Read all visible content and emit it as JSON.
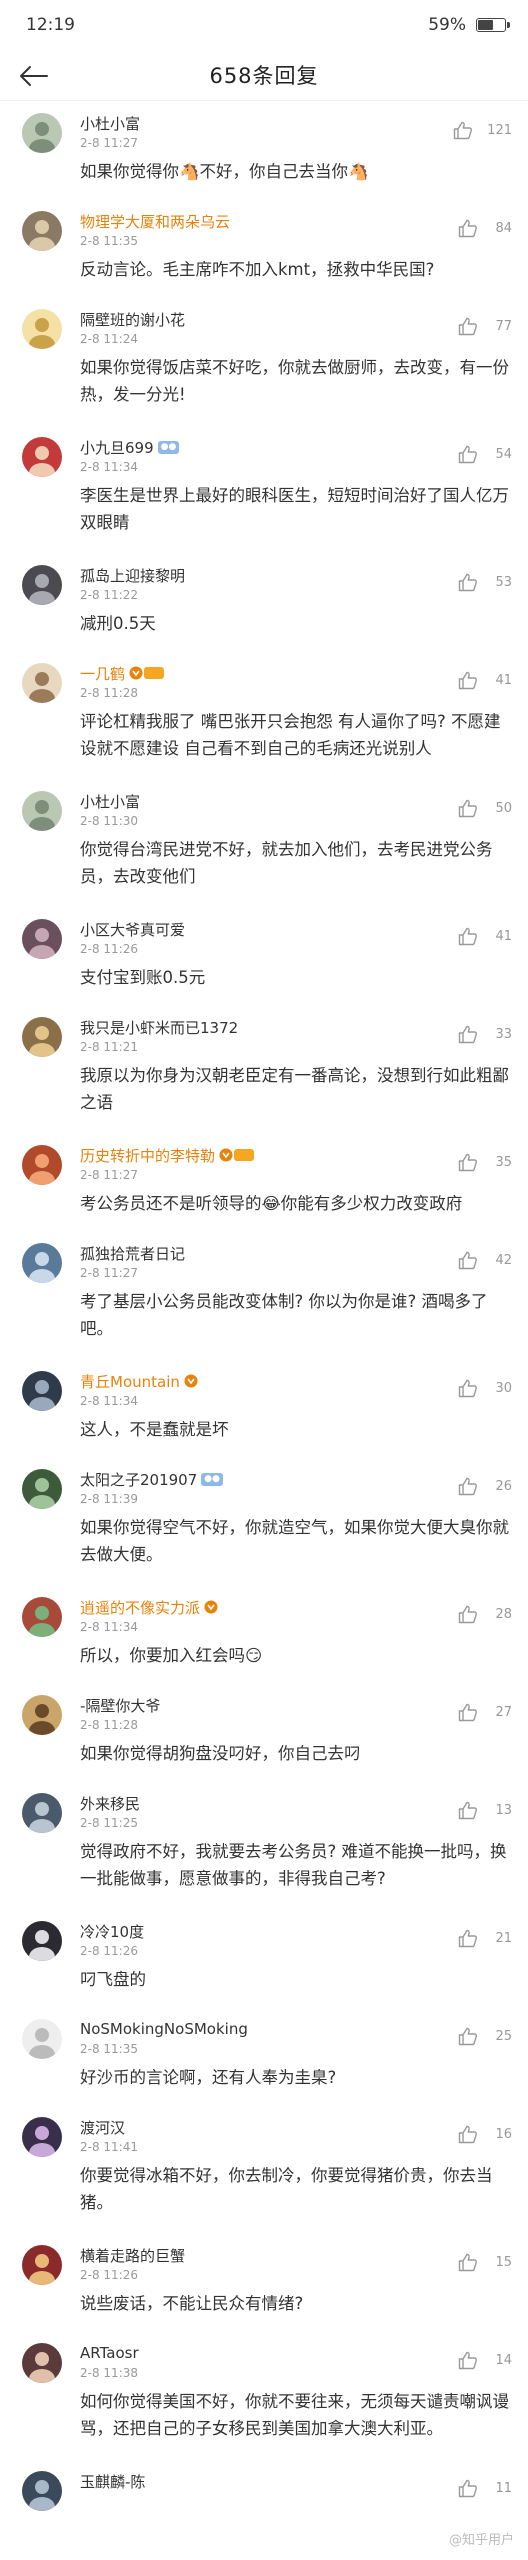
{
  "status_bar": {
    "time": "12:19",
    "battery": "59%",
    "battery_level": 0.59
  },
  "header": {
    "title": "658条回复"
  },
  "comments": [
    {
      "name": "小杜小富",
      "name_style": "normal",
      "badge": "",
      "date": "2-8 11:27",
      "likes": "121",
      "text": "如果你觉得你🐴不好，你自己去当你🐴",
      "avatar_color": "#b9c7b3",
      "avatar_fg": "#7d8f7a"
    },
    {
      "name": "物理学大厦和两朵乌云",
      "name_style": "vip",
      "badge": "",
      "date": "2-8 11:35",
      "likes": "84",
      "text": "反动言论。毛主席咋不加入kmt，拯救中华民国?",
      "avatar_color": "#8a7a64",
      "avatar_fg": "#d9c9a8"
    },
    {
      "name": "隔壁班的谢小花",
      "name_style": "normal",
      "badge": "",
      "date": "2-8 11:24",
      "likes": "77",
      "text": "如果你觉得饭店菜不好吃，你就去做厨师，去改变，有一份热，发一分光!",
      "avatar_color": "#f3e1a6",
      "avatar_fg": "#c9a24a"
    },
    {
      "name": "小九旦699",
      "name_style": "normal",
      "badge": "lv",
      "date": "2-8 11:34",
      "likes": "54",
      "text": "李医生是世界上最好的眼科医生，短短时间治好了国人亿万双眼睛",
      "avatar_color": "#c23a3a",
      "avatar_fg": "#f1c8b0"
    },
    {
      "name": "孤岛上迎接黎明",
      "name_style": "normal",
      "badge": "",
      "date": "2-8 11:22",
      "likes": "53",
      "text": "减刑0.5天",
      "avatar_color": "#4a4a50",
      "avatar_fg": "#a8a8b0"
    },
    {
      "name": "一几鹤",
      "name_style": "vip",
      "badge": "vip",
      "date": "2-8 11:28",
      "likes": "41",
      "text": "评论杠精我服了 嘴巴张开只会抱怨 有人逼你了吗? 不愿建设就不愿建设 自己看不到自己的毛病还光说别人",
      "avatar_color": "#e8d8c0",
      "avatar_fg": "#9b7b5a"
    },
    {
      "name": "小杜小富",
      "name_style": "normal",
      "badge": "",
      "date": "2-8 11:30",
      "likes": "50",
      "text": "你觉得台湾民进党不好，就去加入他们，去考民进党公务员，去改变他们",
      "avatar_color": "#b9c7b3",
      "avatar_fg": "#7d8f7a"
    },
    {
      "name": "小区大爷真可爱",
      "name_style": "normal",
      "badge": "",
      "date": "2-8 11:26",
      "likes": "41",
      "text": "支付宝到账0.5元",
      "avatar_color": "#6a4f5c",
      "avatar_fg": "#c7a6b4"
    },
    {
      "name": "我只是小虾米而已1372",
      "name_style": "normal",
      "badge": "",
      "date": "2-8 11:21",
      "likes": "33",
      "text": "我原以为你身为汉朝老臣定有一番高论，没想到行如此粗鄙之语",
      "avatar_color": "#8a6f48",
      "avatar_fg": "#e2c38a"
    },
    {
      "name": "历史转折中的李特勒",
      "name_style": "vip",
      "badge": "vip",
      "date": "2-8 11:27",
      "likes": "35",
      "text": "考公务员还不是听领导的😂你能有多少权力改变政府",
      "avatar_color": "#b04a2a",
      "avatar_fg": "#f0a070"
    },
    {
      "name": "孤独拾荒者日记",
      "name_style": "normal",
      "badge": "",
      "date": "2-8 11:27",
      "likes": "42",
      "text": "考了基层小公务员能改变体制? 你以为你是谁? 酒喝多了吧。",
      "avatar_color": "#5a7a9a",
      "avatar_fg": "#c8d8e8"
    },
    {
      "name": "青丘Mountain",
      "name_style": "vip",
      "badge": "vip-icon",
      "date": "2-8 11:34",
      "likes": "30",
      "text": "这人，不是蠢就是坏",
      "avatar_color": "#2f3a4a",
      "avatar_fg": "#9aa8bb"
    },
    {
      "name": "太阳之子201907",
      "name_style": "normal",
      "badge": "lv",
      "date": "2-8 11:39",
      "likes": "26",
      "text": "如果你觉得空气不好，你就造空气，如果你觉大便大臭你就去做大便。",
      "avatar_color": "#3d5a3a",
      "avatar_fg": "#9fc29a"
    },
    {
      "name": "逍遥的不像实力派",
      "name_style": "vip",
      "badge": "vip-icon",
      "date": "2-8 11:34",
      "likes": "28",
      "text": "所以，你要加入红会吗😏",
      "avatar_color": "#a84a3a",
      "avatar_fg": "#7ab07a"
    },
    {
      "name": "-隔壁你大爷",
      "name_style": "normal",
      "badge": "",
      "date": "2-8 11:28",
      "likes": "27",
      "text": "如果你觉得胡狗盘没叼好，你自己去叼",
      "avatar_color": "#c9a56a",
      "avatar_fg": "#6a4a2a"
    },
    {
      "name": "外来移民",
      "name_style": "normal",
      "badge": "",
      "date": "2-8 11:25",
      "likes": "13",
      "text": "觉得政府不好，我就要去考公务员? 难道不能换一批吗，换一批能做事，愿意做事的，非得我自己考?",
      "avatar_color": "#4a5a6a",
      "avatar_fg": "#b8c4d0"
    },
    {
      "name": "冷冷10度",
      "name_style": "normal",
      "badge": "",
      "date": "2-8 11:26",
      "likes": "21",
      "text": "叼飞盘的",
      "avatar_color": "#2a2a30",
      "avatar_fg": "#dcdce0"
    },
    {
      "name": "NoSMokingNoSMoking",
      "name_style": "normal",
      "badge": "",
      "date": "2-8 11:35",
      "likes": "25",
      "text": "好沙币的言论啊，还有人奉为圭臬?",
      "avatar_color": "#eeeeee",
      "avatar_fg": "#bbbbbb"
    },
    {
      "name": "渡河汉",
      "name_style": "normal",
      "badge": "",
      "date": "2-8 11:41",
      "likes": "16",
      "text": "你要觉得冰箱不好，你去制冷，你要觉得猪价贵，你去当猪。",
      "avatar_color": "#3a2f4a",
      "avatar_fg": "#c8a8d8"
    },
    {
      "name": "横着走路的巨蟹",
      "name_style": "normal",
      "badge": "",
      "date": "2-8 11:26",
      "likes": "15",
      "text": "说些废话，不能让民众有情绪?",
      "avatar_color": "#8a2a2a",
      "avatar_fg": "#e8b878"
    },
    {
      "name": "ARTaosr",
      "name_style": "normal",
      "badge": "",
      "date": "2-8 11:38",
      "likes": "14",
      "text": "如何你觉得美国不好，你就不要往来，无须每天谴责嘲讽谩骂，还把自己的子女移民到美国加拿大澳大利亚。",
      "avatar_color": "#5a3a3a",
      "avatar_fg": "#e0c0a8"
    },
    {
      "name": "玉麒麟-陈",
      "name_style": "normal",
      "badge": "",
      "date": "",
      "likes": "11",
      "text": "",
      "avatar_color": "#3a4a5a",
      "avatar_fg": "#a8b8c8"
    }
  ],
  "watermark": "@知乎用户"
}
